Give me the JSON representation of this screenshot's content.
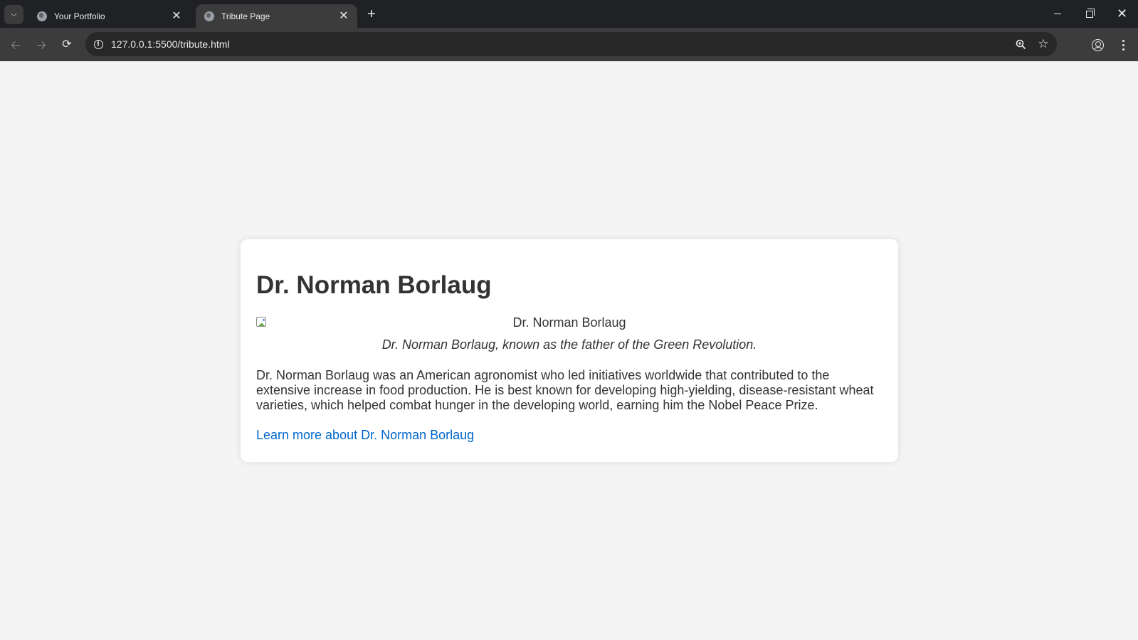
{
  "browser": {
    "tabs": [
      {
        "title": "Your Portfolio",
        "active": false
      },
      {
        "title": "Tribute Page",
        "active": true
      }
    ],
    "new_tab_label": "+",
    "url": "127.0.0.1:5500/tribute.html"
  },
  "page": {
    "title": "Dr. Norman Borlaug",
    "image_alt": "Dr. Norman Borlaug",
    "caption": "Dr. Norman Borlaug, known as the father of the Green Revolution.",
    "body": "Dr. Norman Borlaug was an American agronomist who led initiatives worldwide that contributed to the extensive increase in food production. He is best known for developing high-yielding, disease-resistant wheat varieties, which helped combat hunger in the developing world, earning him the Nobel Peace Prize.",
    "link_text": "Learn more about Dr. Norman Borlaug"
  },
  "colors": {
    "page_background": "#f4f4f4",
    "card_background": "#ffffff",
    "text": "#333333",
    "link": "#0066cc",
    "browser_chrome": "#202124",
    "toolbar": "#3c3c3c"
  }
}
